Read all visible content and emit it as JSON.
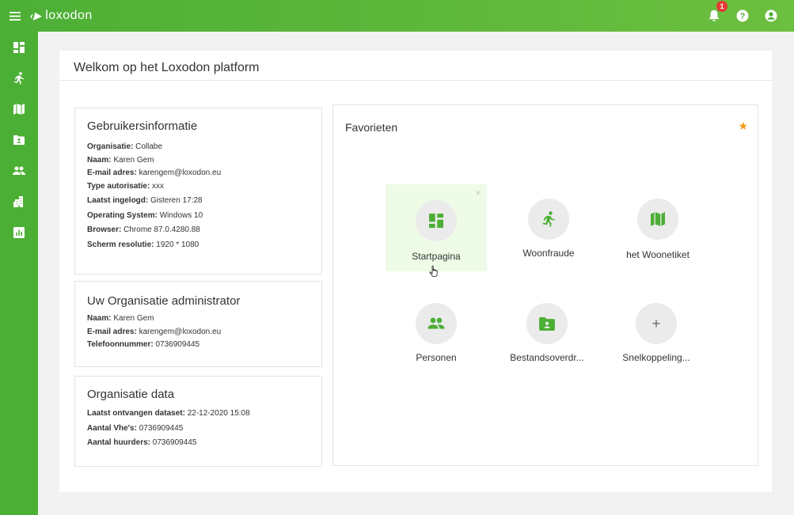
{
  "app": {
    "logo_text": "loxodon"
  },
  "header": {
    "notification_count": "1"
  },
  "sidebar": {
    "items": [
      {
        "icon": "dashboard-icon"
      },
      {
        "icon": "running-person-icon"
      },
      {
        "icon": "map-icon"
      },
      {
        "icon": "folder-shared-icon"
      },
      {
        "icon": "people-icon"
      },
      {
        "icon": "buildings-icon"
      },
      {
        "icon": "bar-chart-icon"
      }
    ]
  },
  "page": {
    "title": "Welkom op het Loxodon platform"
  },
  "user_info": {
    "title": "Gebruikersinformatie",
    "rows": [
      {
        "label": "Organisatie:",
        "value": " Collabe"
      },
      {
        "label": "Naam:",
        "value": " Karen Gem"
      },
      {
        "label": "E-mail adres:",
        "value": " karengem@loxodon.eu"
      },
      {
        "label": "Type autorisatie:",
        "value": " xxx"
      },
      {
        "label": "Laatst ingelogd:",
        "value": "  Gisteren 17:28"
      },
      {
        "label": "Operating System:",
        "value": "  Windows 10"
      },
      {
        "label": "Browser:",
        "value": " Chrome 87.0.4280.88"
      },
      {
        "label": "Scherm resolutie:",
        "value": " 1920 * 1080"
      }
    ]
  },
  "org_admin": {
    "title": "Uw Organisatie administrator",
    "rows": [
      {
        "label": "Naam:",
        "value": " Karen Gem"
      },
      {
        "label": "E-mail adres:",
        "value": " karengem@loxodon.eu"
      },
      {
        "label": "Telefoonnummer:",
        "value": " 0736909445"
      }
    ]
  },
  "org_data": {
    "title": "Organisatie data",
    "rows": [
      {
        "label": "Laatst ontvangen dataset:",
        "value": " 22-12-2020 15:08"
      },
      {
        "label": "Aantal Vhe's:",
        "value": " 0736909445"
      },
      {
        "label": "Aantal huurders:",
        "value": " 0736909445"
      }
    ]
  },
  "favorites": {
    "title": "Favorieten",
    "close_symbol": "×",
    "tiles": [
      {
        "label": "Startpagina",
        "icon": "dashboard-icon"
      },
      {
        "label": "Woonfraude",
        "icon": "running-person-icon"
      },
      {
        "label": "het Woonetiket",
        "icon": "map-icon"
      },
      {
        "label": "Personen",
        "icon": "people-icon"
      },
      {
        "label": "Bestandsoverdr...",
        "icon": "folder-shared-icon"
      },
      {
        "label": "Snelkoppeling...",
        "icon": "plus-icon",
        "symbol": "+"
      }
    ]
  },
  "colors": {
    "brand_green": "#4caf35",
    "star": "#f39c12",
    "badge": "#e53935",
    "tile_active": "#eefbe6"
  }
}
